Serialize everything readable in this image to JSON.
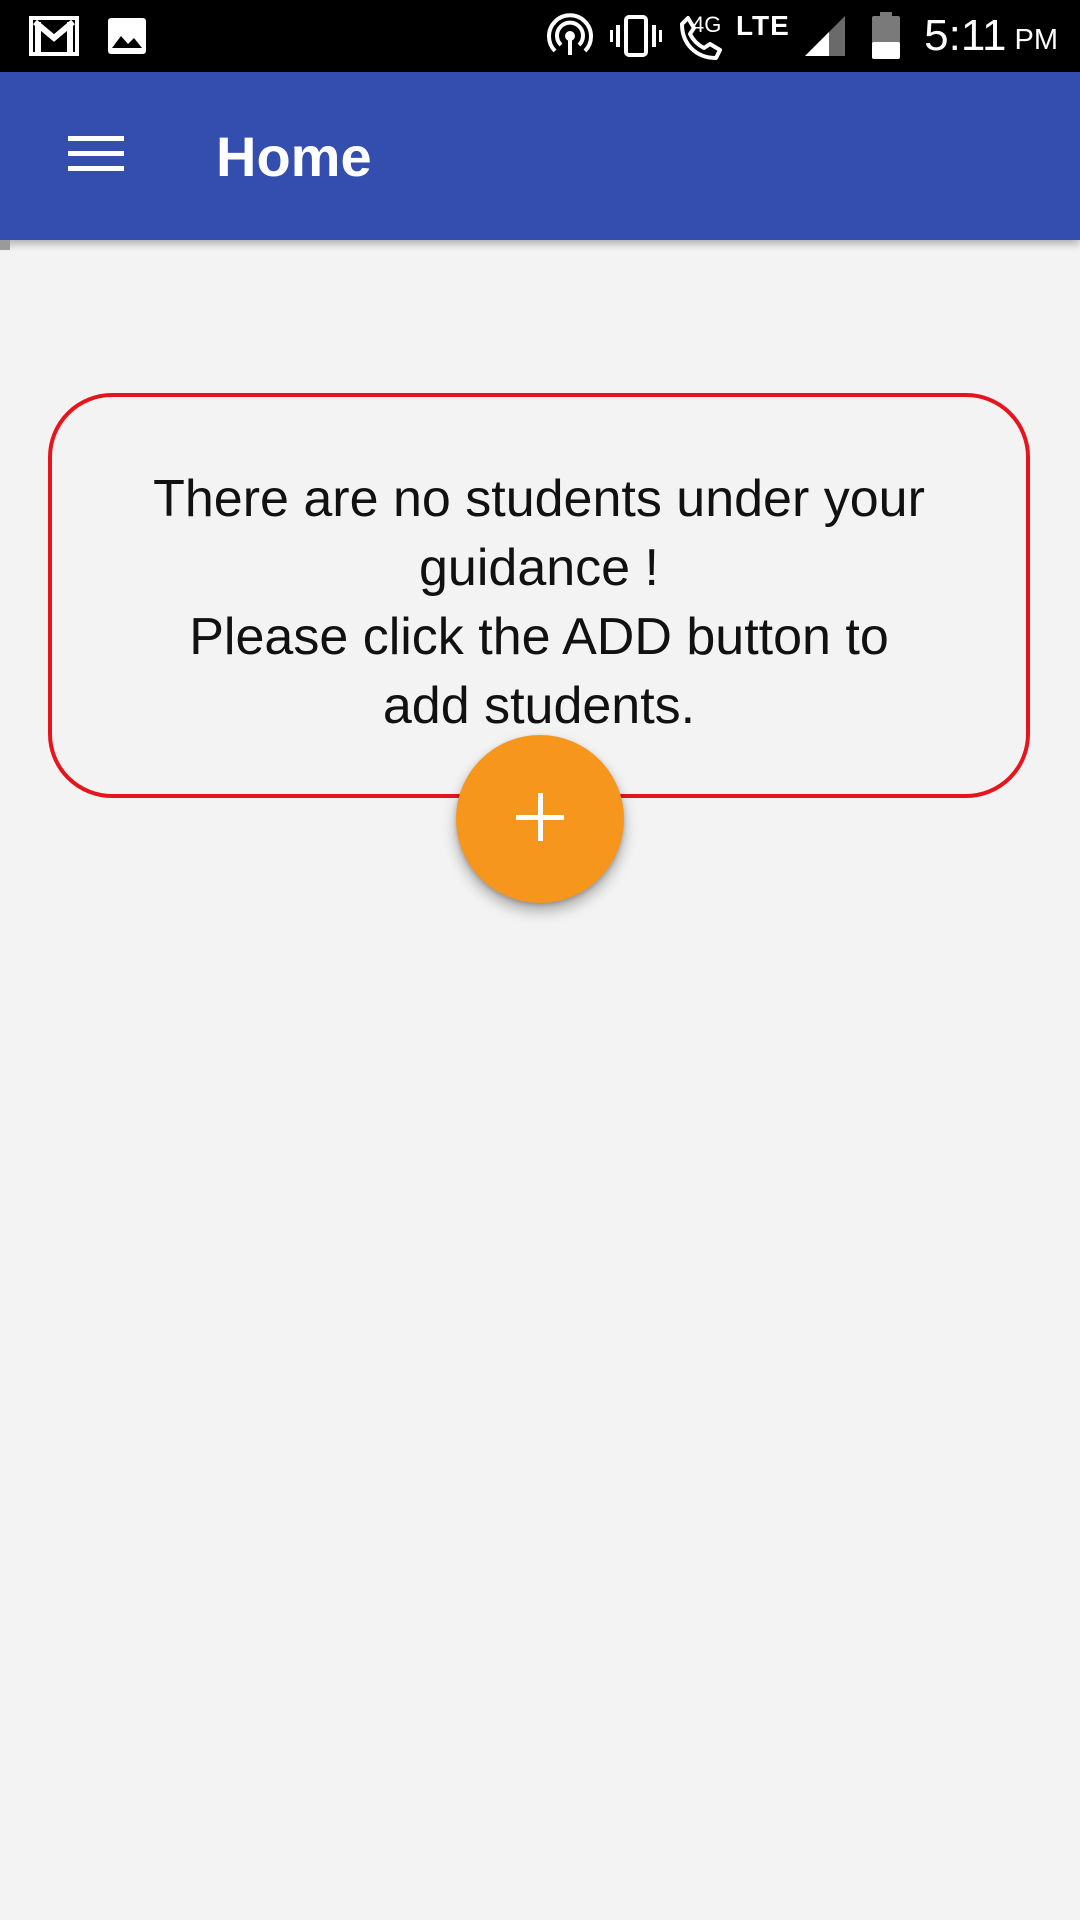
{
  "status_bar": {
    "time": "5:11",
    "ampm": "PM",
    "network_label": "LTE",
    "icons": [
      "gmail-icon",
      "gallery-icon",
      "hotspot-icon",
      "vibrate-icon",
      "volte-call-icon",
      "signal-icon",
      "battery-icon"
    ],
    "volte_label": "4G"
  },
  "app_bar": {
    "title": "Home",
    "background": "#334eae",
    "menu_icon": "hamburger-menu-icon"
  },
  "empty_state": {
    "lines": [
      "There are no students under your",
      "guidance !",
      "Please click the ADD button to",
      "add students."
    ],
    "border_color": "#e8141c"
  },
  "fab": {
    "icon": "plus-icon",
    "color": "#f7961c"
  },
  "colors": {
    "page_background": "#f3f3f3",
    "status_bar": "#000000"
  }
}
